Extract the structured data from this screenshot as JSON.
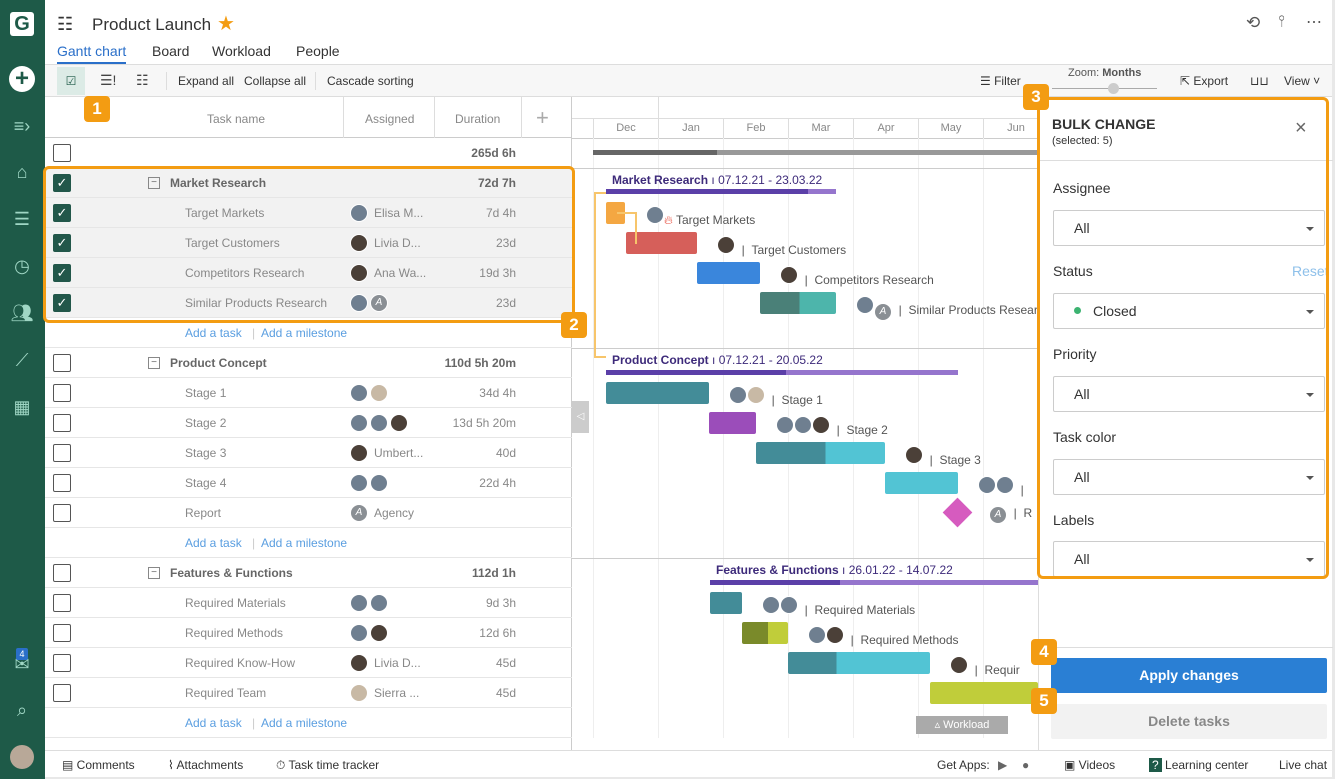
{
  "app": {
    "logo": "G",
    "title": "Product Launch",
    "starred": true,
    "accent": "#2a6fc9",
    "brand": "#1e5a48",
    "highlight": "#f39c12"
  },
  "tabs": [
    {
      "label": "Gantt chart",
      "active": true
    },
    {
      "label": "Board"
    },
    {
      "label": "Workload"
    },
    {
      "label": "People"
    }
  ],
  "toolbar": {
    "expand": "Expand all",
    "collapse": "Collapse all",
    "cascade": "Cascade sorting",
    "filter": "Filter",
    "zoom_label": "Zoom:",
    "zoom_value": "Months",
    "export": "Export",
    "view": "View"
  },
  "sidebar": {
    "notification_count": "4"
  },
  "columns": {
    "task": "Task name",
    "assigned": "Assigned",
    "duration": "Duration"
  },
  "total_duration": "265d 6h",
  "groups": [
    {
      "name": "Market Research",
      "duration": "72d 7h",
      "checked": true,
      "dates": "07.12.21 - 23.03.22",
      "tasks": [
        {
          "name": "Target Markets",
          "assigned": "Elisa M...",
          "duration": "7d 4h",
          "checked": true
        },
        {
          "name": "Target Customers",
          "assigned": "Livia D...",
          "duration": "23d",
          "checked": true
        },
        {
          "name": "Competitors Research",
          "assigned": "Ana Wa...",
          "duration": "19d 3h",
          "checked": true
        },
        {
          "name": "Similar Products Research",
          "assigned": "",
          "duration": "23d",
          "checked": true
        }
      ]
    },
    {
      "name": "Product Concept",
      "duration": "110d 5h 20m",
      "dates": "07.12.21 - 20.05.22",
      "tasks": [
        {
          "name": "Stage 1",
          "duration": "34d 4h"
        },
        {
          "name": "Stage 2",
          "duration": "13d 5h 20m"
        },
        {
          "name": "Stage 3",
          "assigned": "Umbert...",
          "duration": "40d"
        },
        {
          "name": "Stage 4",
          "duration": "22d 4h"
        },
        {
          "name": "Report",
          "assigned": "Agency",
          "duration": ""
        }
      ]
    },
    {
      "name": "Features & Functions",
      "duration": "112d 1h",
      "dates": "26.01.22 - 14.07.22",
      "tasks": [
        {
          "name": "Required Materials",
          "duration": "9d 3h"
        },
        {
          "name": "Required Methods",
          "duration": "12d 6h"
        },
        {
          "name": "Required Know-How",
          "assigned": "Livia D...",
          "duration": "45d"
        },
        {
          "name": "Required Team",
          "assigned": "Sierra ...",
          "duration": "45d"
        }
      ]
    }
  ],
  "add_task": "Add a task",
  "add_milestone": "Add a milestone",
  "months": [
    "Dec",
    "Jan",
    "Feb",
    "Mar",
    "Apr",
    "May",
    "Jun"
  ],
  "gantt_labels": {
    "req_know_how": "Requir",
    "stage4": "",
    "report": "R",
    "workload": "Workload"
  },
  "bulk": {
    "title": "BULK CHANGE",
    "selected": "(selected: 5)",
    "assignee_label": "Assignee",
    "assignee": "All",
    "status_label": "Status",
    "reset": "Reset",
    "status": "Closed",
    "status_color": "#3cb371",
    "priority_label": "Priority",
    "priority": "All",
    "color_label": "Task color",
    "color": "All",
    "labels_label": "Labels",
    "labels": "All",
    "apply": "Apply changes",
    "delete": "Delete tasks"
  },
  "badges": [
    "1",
    "2",
    "3",
    "4",
    "5"
  ],
  "footer": {
    "comments": "Comments",
    "attachments": "Attachments",
    "tracker": "Task time tracker",
    "get_apps": "Get Apps:",
    "videos": "Videos",
    "learning": "Learning center",
    "chat": "Live chat"
  }
}
